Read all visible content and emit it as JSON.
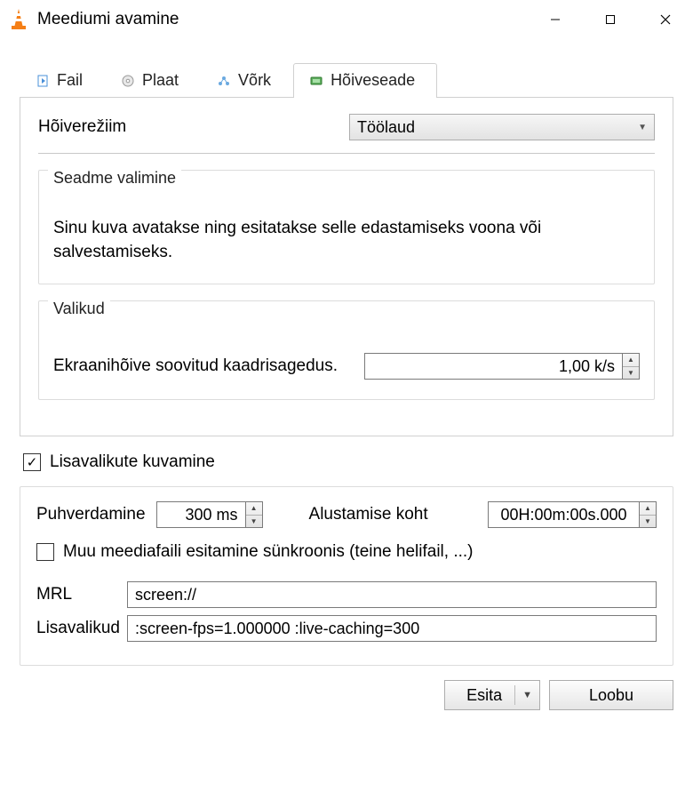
{
  "window": {
    "title": "Meediumi avamine"
  },
  "tabs": {
    "file": "Fail",
    "disc": "Plaat",
    "network": "Võrk",
    "capture": "Hõiveseade"
  },
  "capture": {
    "mode_label": "Hõiverežiim",
    "mode_value": "Töölaud",
    "device_group_title": "Seadme valimine",
    "device_text": "Sinu kuva avatakse ning esitatakse selle edastamiseks voona või salvestamiseks.",
    "options_group_title": "Valikud",
    "fps_label": "Ekraanihõive soovitud kaadrisagedus.",
    "fps_value": "1,00 k/s"
  },
  "show_more_label": "Lisavalikute kuvamine",
  "advanced": {
    "caching_label": "Puhverdamine",
    "caching_value": "300 ms",
    "start_label": "Alustamise koht",
    "start_value": "00H:00m:00s.000",
    "sync_label": "Muu meediafaili esitamine sünkroonis (teine helifail, ...)",
    "mrl_label": "MRL",
    "mrl_value": "screen://",
    "edit_label": "Lisavalikud",
    "edit_value": ":screen-fps=1.000000 :live-caching=300"
  },
  "buttons": {
    "play": "Esita",
    "cancel": "Loobu"
  }
}
